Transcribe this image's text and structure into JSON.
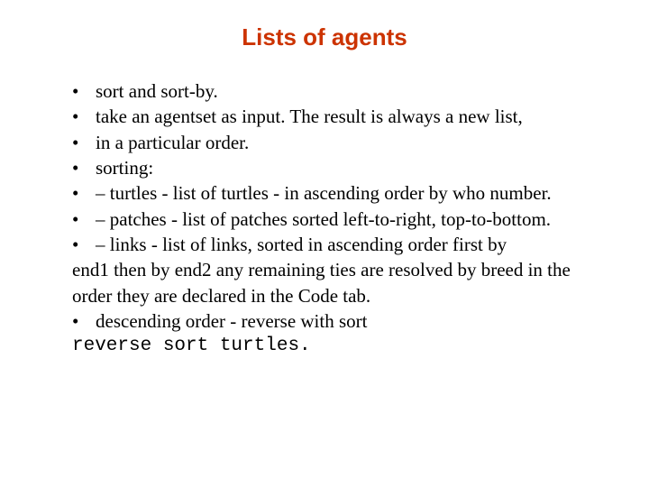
{
  "title": "Lists of agents",
  "bullets": {
    "b1": "sort and sort-by.",
    "b2": "take an agentset as input. The result is always a new list,",
    "b3": "in a particular order.",
    "b4": "sorting:",
    "b5": "– turtles - list of turtles - in ascending order by who number.",
    "b6": "– patches -  list of patches sorted left-to-right, top-to-bottom.",
    "b7_line1": "– links - list of links, sorted in ascending order first by",
    "b7_line2": "end1 then by end2 any remaining ties are resolved by breed in the order they are declared in the Code tab.",
    "b8_line1": "descending order - reverse with sort",
    "b8_code": "reverse sort turtles."
  }
}
